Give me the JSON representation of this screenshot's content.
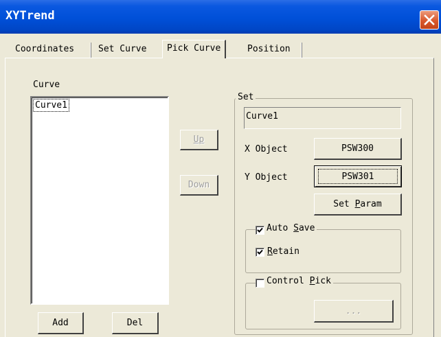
{
  "window": {
    "title": "XYTrend",
    "close_icon": "close-icon"
  },
  "tabs": [
    {
      "label": "Coordinates",
      "selected": false
    },
    {
      "label": "Set Curve",
      "selected": false
    },
    {
      "label": "Pick Curve",
      "selected": true
    },
    {
      "label": "Position",
      "selected": false
    }
  ],
  "curve": {
    "label": "Curve",
    "items": [
      "Curve1"
    ]
  },
  "buttons": {
    "up": "Up",
    "down": "Down",
    "add": "Add",
    "del": "Del",
    "x_object": "PSW300",
    "y_object": "PSW301",
    "set_param": "Set Param",
    "pick": "..."
  },
  "set": {
    "legend": "Set",
    "curve_name": "Curve1",
    "x_object_label": "X Object",
    "y_object_label": "Y Object"
  },
  "options": {
    "auto_save": {
      "label": "Auto Save",
      "checked": true
    },
    "retain": {
      "label": "Retain",
      "checked": true
    },
    "control_pick": {
      "label": "Control Pick",
      "checked": false
    }
  }
}
